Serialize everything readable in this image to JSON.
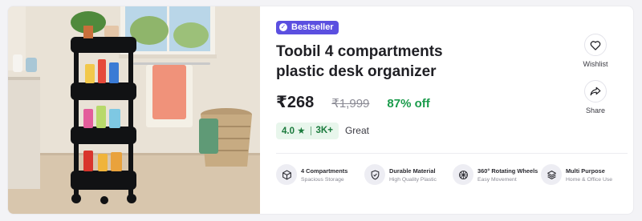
{
  "product": {
    "badge": "Bestseller",
    "badge_icon": "verified-check-icon",
    "title": "Toobil 4 compartments plastic desk organizer",
    "price": "₹268",
    "mrp": "₹1,999",
    "discount": "87% off",
    "rating": "4.0",
    "rating_star": "★",
    "rating_count": "3K+",
    "rating_label": "Great",
    "image_alt": "4-tier black rolling storage cart with bathroom products"
  },
  "actions": [
    {
      "label": "Wishlist",
      "icon": "heart-icon"
    },
    {
      "label": "Share",
      "icon": "share-arrow-icon"
    }
  ],
  "features": [
    {
      "title": "4 Compartments",
      "subtitle": "Spacious Storage",
      "icon": "cube-icon"
    },
    {
      "title": "Durable Material",
      "subtitle": "High Quality Plastic",
      "icon": "shield-check-icon"
    },
    {
      "title": "360° Rotating Wheels",
      "subtitle": "Easy Movement",
      "icon": "wheel-icon"
    },
    {
      "title": "Multi Purpose",
      "subtitle": "Home & Office Use",
      "icon": "layers-icon"
    }
  ],
  "colors": {
    "badge": "#5b4fe0",
    "discount": "#1a9b4b",
    "rating_chip_bg": "#e8f6ec",
    "rating_chip_text": "#1a7a3c"
  }
}
